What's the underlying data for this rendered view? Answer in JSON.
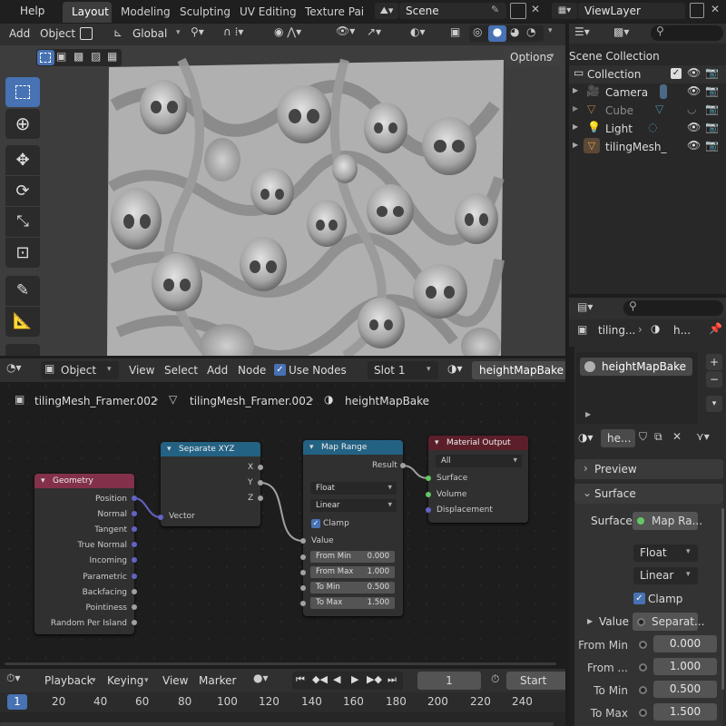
{
  "topbar": {
    "menu_help": "Help",
    "tabs": [
      "Layout",
      "Modeling",
      "Sculpting",
      "UV Editing",
      "Texture Paint"
    ],
    "scene": "Scene",
    "view_layer": "ViewLayer"
  },
  "viewport_header": {
    "add": "Add",
    "object": "Object",
    "orientation": "Global",
    "options": "Options"
  },
  "outliner": {
    "title": "Scene Collection",
    "collection": "Collection",
    "items": [
      "Camera",
      "Cube",
      "Light",
      "tilingMesh_Fr"
    ]
  },
  "properties": {
    "breadcrumb_object": "tiling...",
    "breadcrumb_material": "h...",
    "material_slot": "heightMapBake",
    "material_short": "he...",
    "preview_label": "Preview",
    "surface_panel": "Surface",
    "surface_label": "Surface",
    "surface_value": "Map Ra...",
    "data_type": "Float",
    "interpolation": "Linear",
    "clamp_label": "Clamp",
    "value_label": "Value",
    "value_link": "Separat...",
    "rows": [
      {
        "label": "From Min",
        "value": "0.000"
      },
      {
        "label": "From ...",
        "value": "1.000"
      },
      {
        "label": "To Min",
        "value": "0.500"
      },
      {
        "label": "To Max",
        "value": "1.500"
      }
    ]
  },
  "node_editor_header": {
    "mode": "Object",
    "menus": [
      "View",
      "Select",
      "Add",
      "Node"
    ],
    "use_nodes": "Use Nodes",
    "slot": "Slot 1",
    "material": "heightMapBake"
  },
  "breadcrumbs": [
    "tilingMesh_Framer.002",
    "tilingMesh_Framer.002",
    "heightMapBake"
  ],
  "nodes": {
    "geometry": {
      "title": "Geometry",
      "outputs": [
        "Position",
        "Normal",
        "Tangent",
        "True Normal",
        "Incoming",
        "Parametric",
        "Backfacing",
        "Pointiness",
        "Random Per Island"
      ]
    },
    "separate": {
      "title": "Separate XYZ",
      "outputs": [
        "X",
        "Y",
        "Z"
      ],
      "input": "Vector"
    },
    "maprange": {
      "title": "Map Range",
      "output": "Result",
      "data_type": "Float",
      "interpolation": "Linear",
      "clamp": "Clamp",
      "value": "Value",
      "fields": [
        {
          "label": "From Min",
          "value": "0.000"
        },
        {
          "label": "From Max",
          "value": "1.000"
        },
        {
          "label": "To Min",
          "value": "0.500"
        },
        {
          "label": "To Max",
          "value": "1.500"
        }
      ]
    },
    "output": {
      "title": "Material Output",
      "target": "All",
      "inputs": [
        "Surface",
        "Volume",
        "Displacement"
      ]
    }
  },
  "timeline": {
    "menus": [
      "Playback",
      "Keying",
      "View",
      "Marker"
    ],
    "current_frame": "1",
    "start_label": "Start",
    "ruler": [
      "1",
      "20",
      "40",
      "60",
      "80",
      "100",
      "120",
      "140",
      "160",
      "180",
      "200",
      "220",
      "240"
    ]
  },
  "colors": {
    "accent": "#4772b3",
    "geometry_header": "#83314a",
    "converter_header": "#246283",
    "output_header": "#5c1f2a",
    "socket_vector": "#6363c7",
    "socket_float": "#a1a1a1",
    "socket_shader": "#63c763"
  }
}
